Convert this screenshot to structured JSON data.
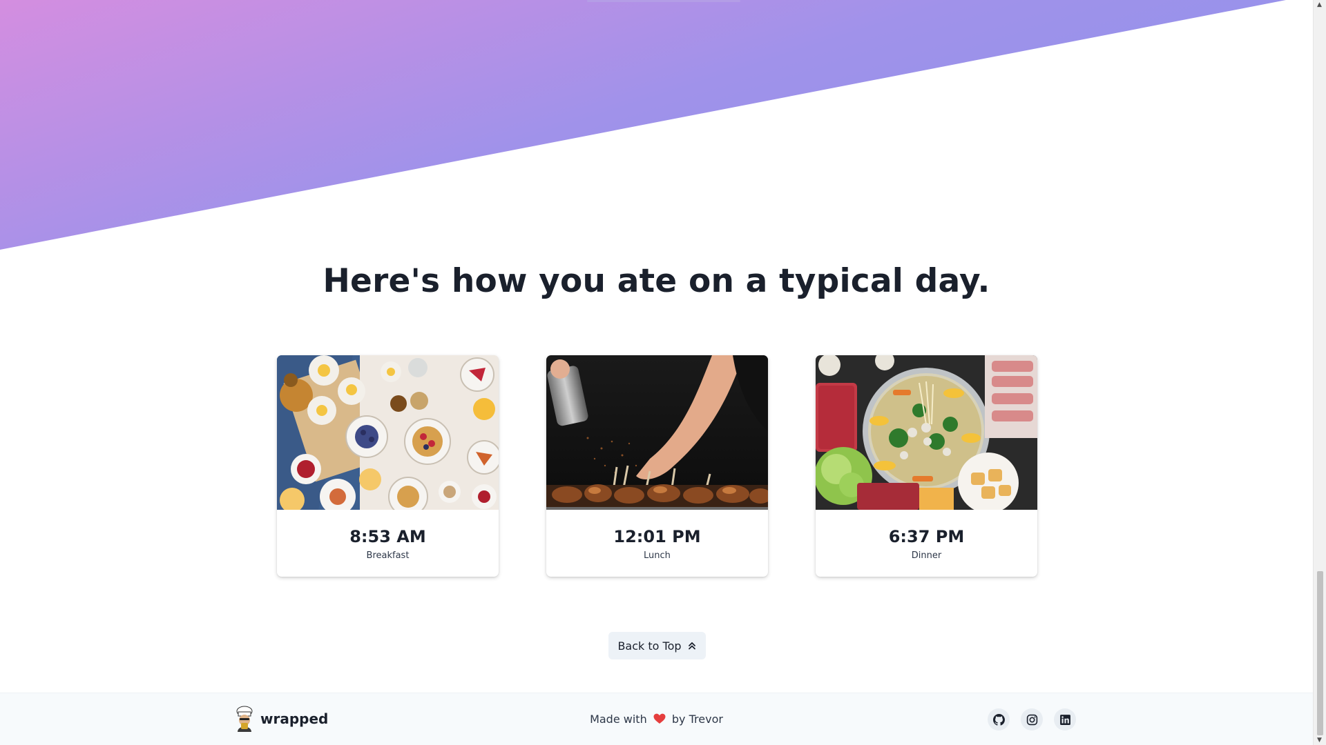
{
  "section": {
    "title": "Here's how you ate on a typical day."
  },
  "meals": [
    {
      "time": "8:53 AM",
      "label": "Breakfast",
      "image": "breakfast-table-photo"
    },
    {
      "time": "12:01 PM",
      "label": "Lunch",
      "image": "grilled-skewers-photo"
    },
    {
      "time": "6:37 PM",
      "label": "Dinner",
      "image": "hot-pot-photo"
    }
  ],
  "back_to_top": {
    "label": "Back to Top",
    "icon": "chevrons-up-icon"
  },
  "footer": {
    "brand": "wrapped",
    "made_with_prefix": "Made with",
    "made_with_suffix": "by Trevor",
    "heart_icon": "heart-icon",
    "socials": [
      "github-icon",
      "instagram-icon",
      "linkedin-icon"
    ]
  },
  "colors": {
    "gradient_start": "#d48ee0",
    "gradient_end": "#8f92ec",
    "footer_bg": "#f7fafc",
    "button_bg": "#edf2f7",
    "heart": "#e53e3e"
  }
}
